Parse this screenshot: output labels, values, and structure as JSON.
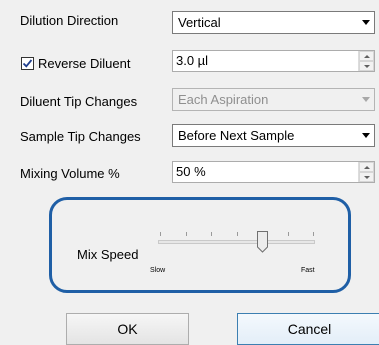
{
  "fields": {
    "dilution_direction": {
      "label": "Dilution Direction",
      "value": "Vertical"
    },
    "reverse_diluent": {
      "label": "Reverse Diluent",
      "checked": true,
      "value": "3.0 µl"
    },
    "diluent_tip_changes": {
      "label": "Diluent Tip Changes",
      "value": "Each Aspiration",
      "enabled": false
    },
    "sample_tip_changes": {
      "label": "Sample Tip Changes",
      "value": "Before Next Sample"
    },
    "mixing_volume": {
      "label": "Mixing Volume %",
      "value": "50 %"
    }
  },
  "mix_speed": {
    "label": "Mix Speed",
    "min_label": "Slow",
    "max_label": "Fast",
    "tick_count": 7,
    "selected_tick": 4
  },
  "buttons": {
    "ok": "OK",
    "cancel": "Cancel"
  },
  "colors": {
    "highlight": "#1f5fa6",
    "background": "#f0f0f0"
  },
  "icons": {
    "combo_arrow": "chevron-down-icon",
    "spin_up": "arrow-up-icon",
    "spin_down": "arrow-down-icon",
    "checkbox": "check-icon"
  }
}
